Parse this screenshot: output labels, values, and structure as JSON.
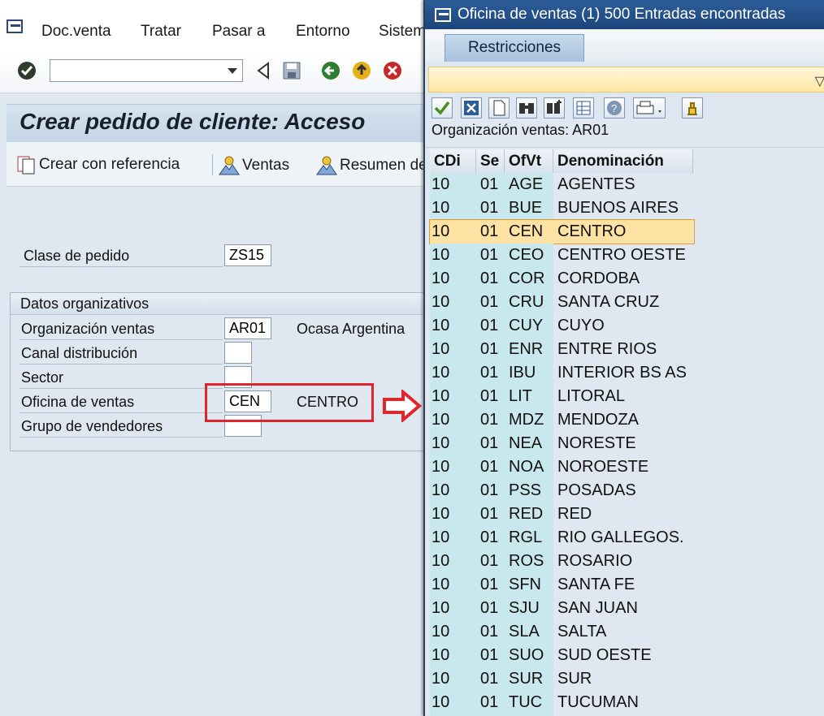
{
  "menu": {
    "items": [
      "Doc.venta",
      "Tratar",
      "Pasar a",
      "Entorno",
      "Sistema"
    ]
  },
  "toolbar": {
    "command_field_value": ""
  },
  "page": {
    "title": "Crear pedido de cliente: Acceso",
    "buttons": [
      "Crear con referencia",
      "Ventas",
      "Resumen de"
    ]
  },
  "form": {
    "clase_label": "Clase de pedido",
    "clase_value": "ZS15",
    "group_title": "Datos organizativos",
    "fields": [
      {
        "label": "Organización ventas",
        "value": "AR01",
        "desc": "Ocasa Argentina"
      },
      {
        "label": "Canal distribución",
        "value": "",
        "desc": ""
      },
      {
        "label": "Sector",
        "value": "",
        "desc": ""
      },
      {
        "label": "Oficina de ventas",
        "value": "CEN",
        "desc": "CENTRO"
      },
      {
        "label": "Grupo de vendedores",
        "value": "",
        "desc": ""
      }
    ]
  },
  "popup": {
    "title": "Oficina de ventas (1)  500 Entradas encontradas",
    "tab": "Restricciones",
    "org_info": "Organización ventas: AR01",
    "columns": [
      "CDi",
      "Se",
      "OfVt",
      "Denominación"
    ],
    "selected_index": 2,
    "rows": [
      [
        "10",
        "01",
        "AGE",
        "AGENTES"
      ],
      [
        "10",
        "01",
        "BUE",
        "BUENOS AIRES"
      ],
      [
        "10",
        "01",
        "CEN",
        "CENTRO"
      ],
      [
        "10",
        "01",
        "CEO",
        "CENTRO OESTE"
      ],
      [
        "10",
        "01",
        "COR",
        "CORDOBA"
      ],
      [
        "10",
        "01",
        "CRU",
        "SANTA CRUZ"
      ],
      [
        "10",
        "01",
        "CUY",
        "CUYO"
      ],
      [
        "10",
        "01",
        "ENR",
        "ENTRE RIOS"
      ],
      [
        "10",
        "01",
        "IBU",
        "INTERIOR BS AS"
      ],
      [
        "10",
        "01",
        "LIT",
        "LITORAL"
      ],
      [
        "10",
        "01",
        "MDZ",
        "MENDOZA"
      ],
      [
        "10",
        "01",
        "NEA",
        "NORESTE"
      ],
      [
        "10",
        "01",
        "NOA",
        "NOROESTE"
      ],
      [
        "10",
        "01",
        "PSS",
        "POSADAS"
      ],
      [
        "10",
        "01",
        "RED",
        "RED"
      ],
      [
        "10",
        "01",
        "RGL",
        "RIO GALLEGOS."
      ],
      [
        "10",
        "01",
        "ROS",
        "ROSARIO"
      ],
      [
        "10",
        "01",
        "SFN",
        "SANTA FE"
      ],
      [
        "10",
        "01",
        "SJU",
        "SAN JUAN"
      ],
      [
        "10",
        "01",
        "SLA",
        "SALTA"
      ],
      [
        "10",
        "01",
        "SUO",
        "SUD OESTE"
      ],
      [
        "10",
        "01",
        "SUR",
        "SUR"
      ],
      [
        "10",
        "01",
        "TUC",
        "TUCUMAN"
      ]
    ]
  },
  "colors": {
    "highlight_red": "#e0262a",
    "popup_title_bg": "#1d457b",
    "selected_row": "#fde2a3",
    "key_column": "#c9e8ee"
  }
}
